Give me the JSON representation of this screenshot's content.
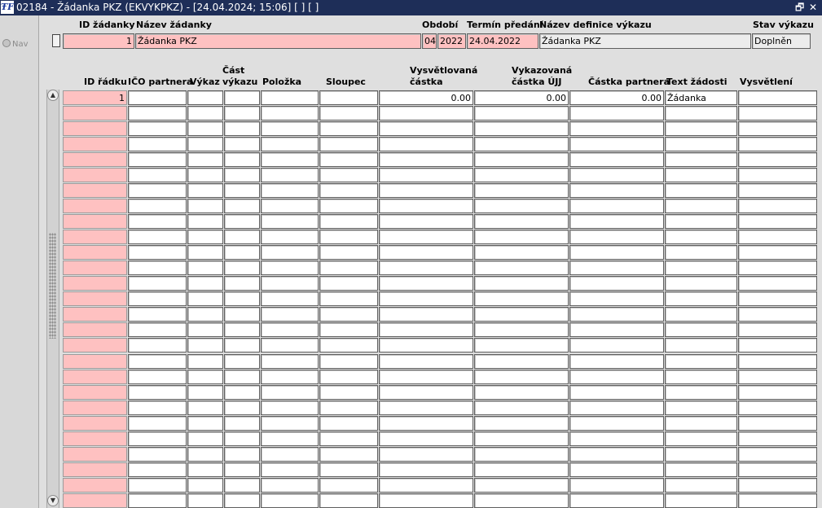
{
  "window": {
    "title": "02184 - Žádanka PKZ (EKVYKPKZ) - [24.04.2024; 15:06]  [ ]  [ ]",
    "restore_glyph": "🗗",
    "close_glyph": "✕"
  },
  "nav": {
    "label": "Nav"
  },
  "header": {
    "labels": {
      "id": "ID žádanky",
      "name": "Název žádanky",
      "period": "Období",
      "deadline": "Termín předání",
      "definition": "Název definice výkazu",
      "status": "Stav výkazu"
    },
    "values": {
      "id": "1",
      "name": "Žádanka PKZ",
      "period_month": "04",
      "period_year": "2022",
      "deadline": "24.04.2022",
      "definition": "Žádanka PKZ",
      "status": "Doplněn"
    }
  },
  "grid": {
    "columns": [
      {
        "key": "id_radku",
        "lines": [
          "ID řádku"
        ]
      },
      {
        "key": "ico",
        "lines": [
          "IČO partnera"
        ]
      },
      {
        "key": "vykaz",
        "lines": [
          "Výkaz"
        ]
      },
      {
        "key": "cast",
        "lines": [
          "Část",
          "výkazu"
        ]
      },
      {
        "key": "polozka",
        "lines": [
          "Položka"
        ]
      },
      {
        "key": "sloupec",
        "lines": [
          "Sloupec"
        ]
      },
      {
        "key": "vysvetlovana",
        "lines": [
          "Vysvětlovaná",
          "částka"
        ]
      },
      {
        "key": "vykazovana",
        "lines": [
          "Vykazovaná",
          "částka ÚJJ"
        ]
      },
      {
        "key": "partnera",
        "lines": [
          "Částka partnera"
        ]
      },
      {
        "key": "text",
        "lines": [
          "Text žádosti"
        ]
      },
      {
        "key": "vysvetleni",
        "lines": [
          "Vysvětlení"
        ]
      }
    ],
    "rows": [
      [
        "1",
        "",
        "",
        "",
        "",
        "",
        "0.00",
        "0.00",
        "0.00",
        "Žádanka",
        ""
      ],
      [
        "",
        "",
        "",
        "",
        "",
        "",
        "",
        "",
        "",
        "",
        ""
      ],
      [
        "",
        "",
        "",
        "",
        "",
        "",
        "",
        "",
        "",
        "",
        ""
      ],
      [
        "",
        "",
        "",
        "",
        "",
        "",
        "",
        "",
        "",
        "",
        ""
      ],
      [
        "",
        "",
        "",
        "",
        "",
        "",
        "",
        "",
        "",
        "",
        ""
      ],
      [
        "",
        "",
        "",
        "",
        "",
        "",
        "",
        "",
        "",
        "",
        ""
      ],
      [
        "",
        "",
        "",
        "",
        "",
        "",
        "",
        "",
        "",
        "",
        ""
      ],
      [
        "",
        "",
        "",
        "",
        "",
        "",
        "",
        "",
        "",
        "",
        ""
      ],
      [
        "",
        "",
        "",
        "",
        "",
        "",
        "",
        "",
        "",
        "",
        ""
      ],
      [
        "",
        "",
        "",
        "",
        "",
        "",
        "",
        "",
        "",
        "",
        ""
      ],
      [
        "",
        "",
        "",
        "",
        "",
        "",
        "",
        "",
        "",
        "",
        ""
      ],
      [
        "",
        "",
        "",
        "",
        "",
        "",
        "",
        "",
        "",
        "",
        ""
      ],
      [
        "",
        "",
        "",
        "",
        "",
        "",
        "",
        "",
        "",
        "",
        ""
      ],
      [
        "",
        "",
        "",
        "",
        "",
        "",
        "",
        "",
        "",
        "",
        ""
      ],
      [
        "",
        "",
        "",
        "",
        "",
        "",
        "",
        "",
        "",
        "",
        ""
      ],
      [
        "",
        "",
        "",
        "",
        "",
        "",
        "",
        "",
        "",
        "",
        ""
      ],
      [
        "",
        "",
        "",
        "",
        "",
        "",
        "",
        "",
        "",
        "",
        ""
      ],
      [
        "",
        "",
        "",
        "",
        "",
        "",
        "",
        "",
        "",
        "",
        ""
      ],
      [
        "",
        "",
        "",
        "",
        "",
        "",
        "",
        "",
        "",
        "",
        ""
      ],
      [
        "",
        "",
        "",
        "",
        "",
        "",
        "",
        "",
        "",
        "",
        ""
      ],
      [
        "",
        "",
        "",
        "",
        "",
        "",
        "",
        "",
        "",
        "",
        ""
      ],
      [
        "",
        "",
        "",
        "",
        "",
        "",
        "",
        "",
        "",
        "",
        ""
      ],
      [
        "",
        "",
        "",
        "",
        "",
        "",
        "",
        "",
        "",
        "",
        ""
      ],
      [
        "",
        "",
        "",
        "",
        "",
        "",
        "",
        "",
        "",
        "",
        ""
      ],
      [
        "",
        "",
        "",
        "",
        "",
        "",
        "",
        "",
        "",
        "",
        ""
      ],
      [
        "",
        "",
        "",
        "",
        "",
        "",
        "",
        "",
        "",
        "",
        ""
      ],
      [
        "",
        "",
        "",
        "",
        "",
        "",
        "",
        "",
        "",
        "",
        ""
      ]
    ]
  },
  "colors": {
    "titlebar": "#1e2e58",
    "required_field": "#fec1c1",
    "background": "#dfdfdf"
  }
}
